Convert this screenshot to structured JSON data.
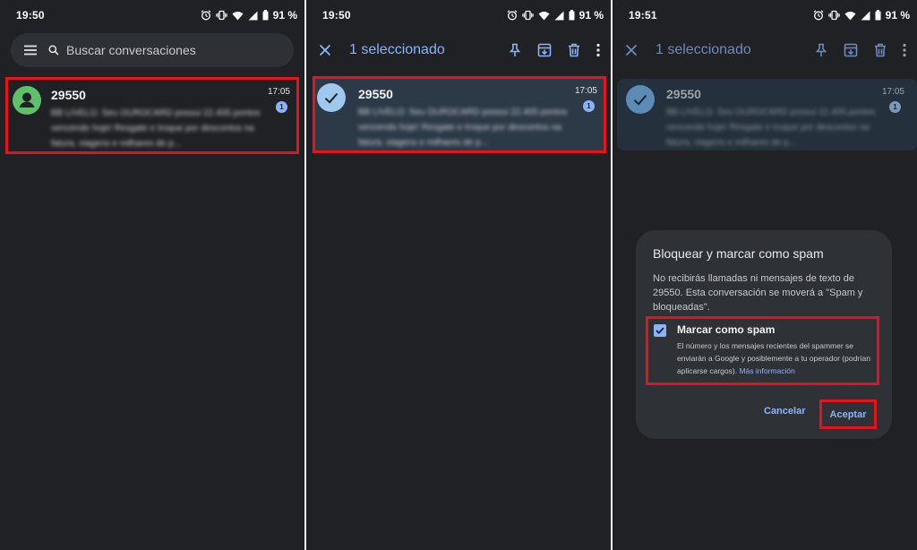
{
  "panels": [
    {
      "status": {
        "time": "19:50",
        "battery": "91 %"
      },
      "search": {
        "placeholder": "Buscar conversaciones"
      },
      "conversation": {
        "sender": "29550",
        "time": "17:05",
        "unread_count": "1",
        "preview": "BB LIVELO: Seu OUROCARD possui 22.405 pontos vencendo hoje! Resgate e troque por descontos na fatura, viagens e milhares de p..."
      }
    },
    {
      "status": {
        "time": "19:50",
        "battery": "91 %"
      },
      "appbar": {
        "title": "1 seleccionado"
      },
      "conversation": {
        "sender": "29550",
        "time": "17:05",
        "unread_count": "1",
        "preview": "BB LIVELO: Seu OUROCARD possui 22.405 pontos vencendo hoje! Resgate e troque por descontos na fatura, viagens e milhares de p..."
      }
    },
    {
      "status": {
        "time": "19:51",
        "battery": "91 %"
      },
      "appbar": {
        "title": "1 seleccionado"
      },
      "conversation": {
        "sender": "29550",
        "time": "17:05",
        "unread_count": "1",
        "preview": "BB LIVELO: Seu OUROCARD possui 22.405 pontos vencendo hoje! Resgate e troque por descontos na fatura, viagens e milhares de p..."
      },
      "dialog": {
        "title": "Bloquear y marcar como spam",
        "body": "No recibirás llamadas ni mensajes de texto de 29550. Esta conversación se moverá a \"Spam y bloqueadas\".",
        "checkbox_label": "Marcar como spam",
        "checkbox_checked": true,
        "checkbox_desc": "El número y los mensajes recientes del spammer se enviarán a Google y posiblemente a tu operador (podrían aplicarse cargos).",
        "more_link": "Más información",
        "cancel": "Cancelar",
        "accept": "Aceptar"
      }
    }
  ],
  "colors": {
    "background": "#1f2124",
    "accent": "#8ab4f8",
    "highlight_box": "#e3141b",
    "avatar": "#5ec06a",
    "selected_row": "#2c3947",
    "dialog": "#2e3236"
  },
  "icons": {
    "status": [
      "alarm-icon",
      "vibrate-icon",
      "wifi-icon",
      "signal-icon",
      "battery-icon"
    ],
    "search_bar": [
      "menu-icon",
      "search-icon"
    ],
    "appbar": [
      "close-icon",
      "pin-icon",
      "archive-icon",
      "delete-icon",
      "more-vert-icon"
    ],
    "conversation": [
      "contact-avatar-icon",
      "check-icon"
    ]
  }
}
